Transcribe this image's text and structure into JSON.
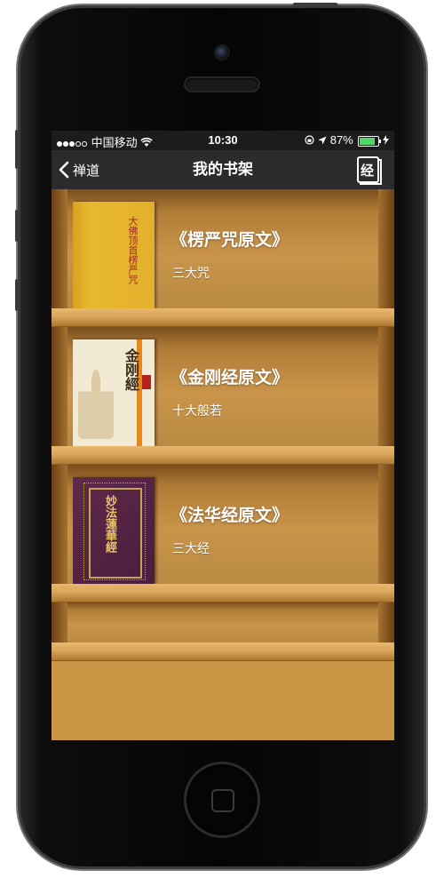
{
  "status_bar": {
    "carrier": "中国移动",
    "time": "10:30",
    "battery_percent": "87%",
    "battery_level": 0.87,
    "signal_bars_filled": 3
  },
  "nav": {
    "back_label": "禅道",
    "title": "我的书架",
    "right_icon_label": "经"
  },
  "books": [
    {
      "title": "《楞严咒原文》",
      "subtitle": "三大咒",
      "cover_text": "大佛顶首楞严咒"
    },
    {
      "title": "《金刚经原文》",
      "subtitle": "十大般若",
      "cover_text": "金刚經"
    },
    {
      "title": "《法华经原文》",
      "subtitle": "三大经",
      "cover_text": "妙法蓮華經"
    }
  ],
  "colors": {
    "shelf_wood": "#c89846",
    "navbar": "#2b2b2b",
    "battery_green": "#4cd964"
  }
}
